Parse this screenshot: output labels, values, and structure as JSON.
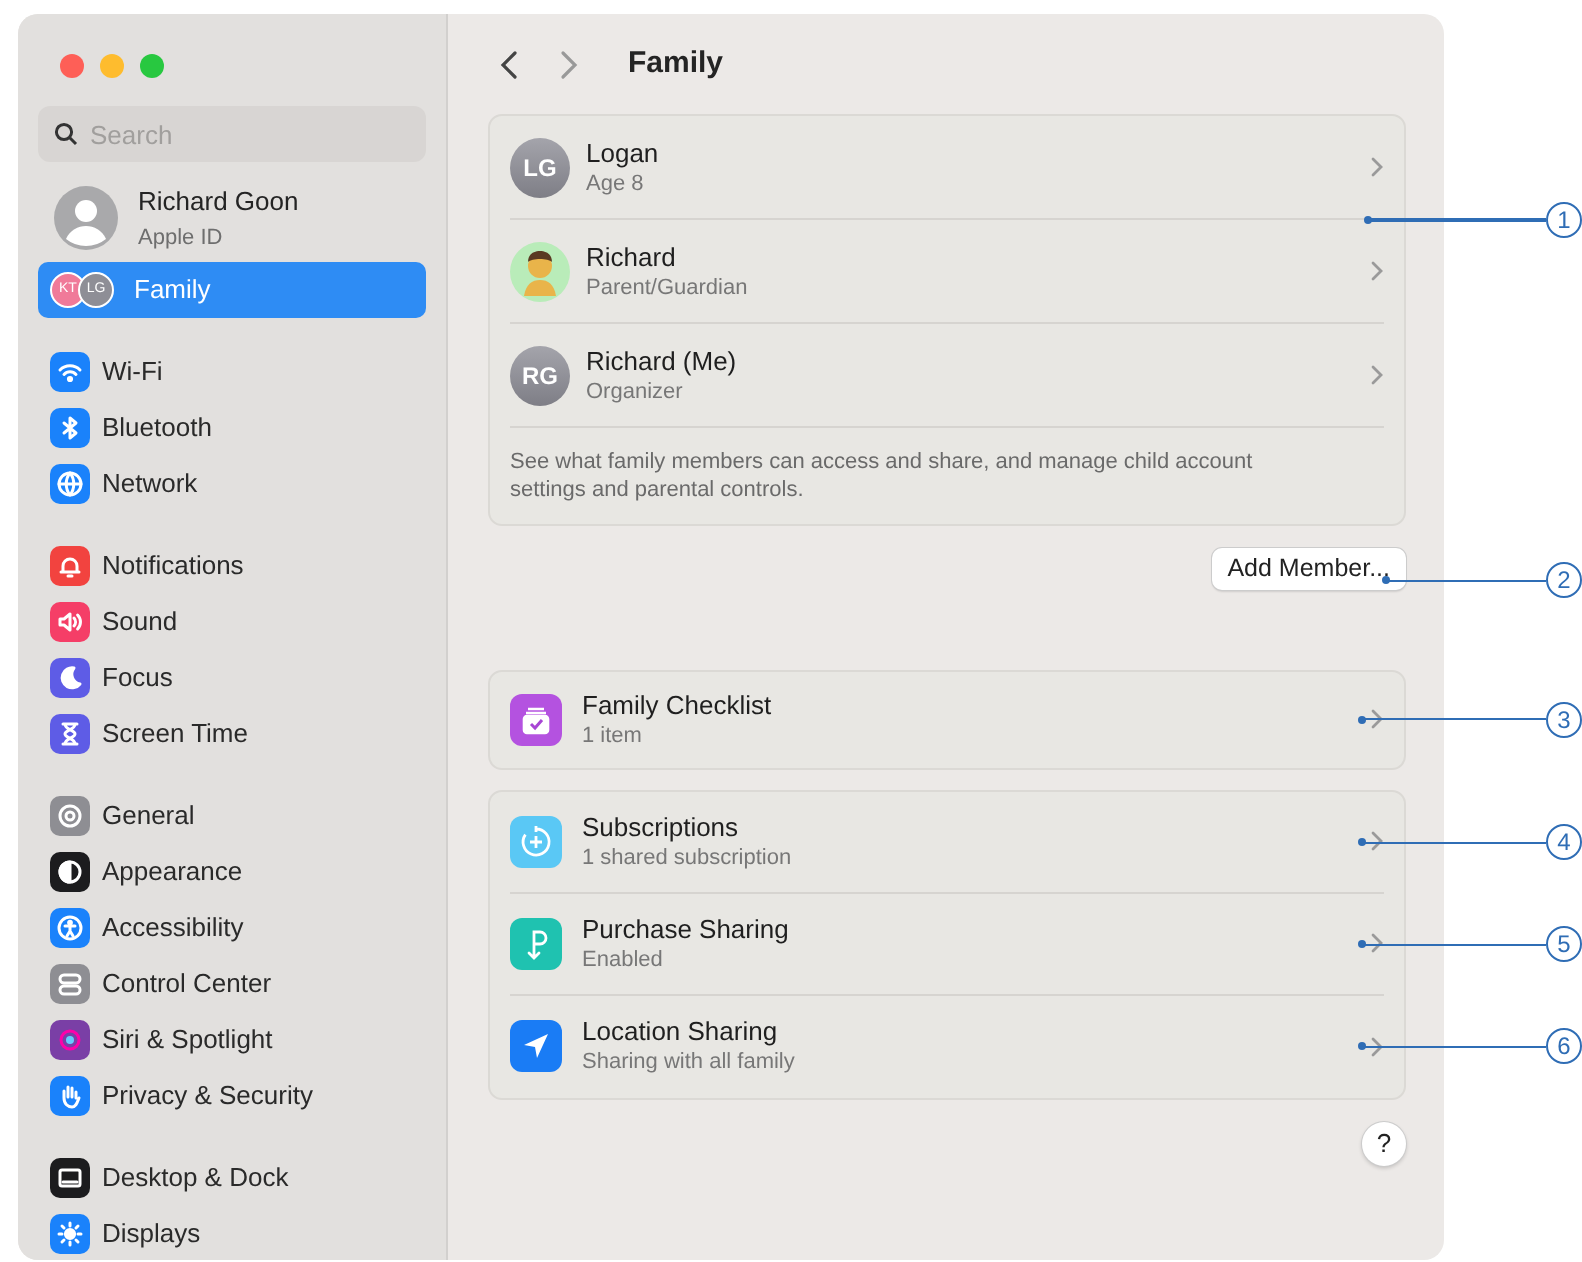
{
  "window": {
    "controls": [
      {
        "color": "#fe5f57"
      },
      {
        "color": "#febc2e"
      },
      {
        "color": "#28c840"
      }
    ]
  },
  "sidebar": {
    "search": {
      "placeholder": "Search"
    },
    "account": {
      "name": "Richard Goon",
      "subtitle": "Apple ID"
    },
    "family": {
      "label": "Family",
      "selected": true,
      "avatars": [
        {
          "initials": "KT",
          "color": "#f07a99"
        },
        {
          "initials": "LG",
          "color": "#8e8e96"
        }
      ]
    },
    "groups": [
      [
        {
          "label": "Wi-Fi",
          "color": "#1a82fb",
          "selected": false
        },
        {
          "label": "Bluetooth",
          "color": "#1a82fb",
          "selected": false
        },
        {
          "label": "Network",
          "color": "#1a82fb",
          "selected": false
        }
      ],
      [
        {
          "label": "Notifications",
          "color": "#f2433f",
          "selected": false
        },
        {
          "label": "Sound",
          "color": "#f53e67",
          "selected": false
        },
        {
          "label": "Focus",
          "color": "#5e5ce6",
          "selected": false
        },
        {
          "label": "Screen Time",
          "color": "#5e5ce6",
          "selected": false
        }
      ],
      [
        {
          "label": "General",
          "color": "#8e8e93",
          "selected": false
        },
        {
          "label": "Appearance",
          "color": "#1c1c1e",
          "selected": false
        },
        {
          "label": "Accessibility",
          "color": "#1a82fb",
          "selected": false
        },
        {
          "label": "Control Center",
          "color": "#8e8e93",
          "selected": false
        },
        {
          "label": "Siri & Spotlight",
          "color": "#7a3fa6",
          "selected": false
        },
        {
          "label": "Privacy & Security",
          "color": "#1a82fb",
          "selected": false
        }
      ],
      [
        {
          "label": "Desktop & Dock",
          "color": "#1c1c1e",
          "selected": false
        },
        {
          "label": "Displays",
          "color": "#1a82fb",
          "selected": false
        }
      ]
    ]
  },
  "main": {
    "title": "Family",
    "members": [
      {
        "kind": "initials",
        "initials": "LG",
        "name": "Logan",
        "subtitle": "Age 8"
      },
      {
        "kind": "picture",
        "name": "Richard",
        "subtitle": "Parent/Guardian"
      },
      {
        "kind": "initials",
        "initials": "RG",
        "name": "Richard (Me)",
        "subtitle": "Organizer"
      }
    ],
    "members_note": "See what family members can access and share, and manage child account settings and parental controls.",
    "add_button": "Add Member...",
    "groups": [
      [
        {
          "title": "Family Checklist",
          "subtitle": "1 item",
          "color": "#b452e0"
        }
      ],
      [
        {
          "title": "Subscriptions",
          "subtitle": "1 shared subscription",
          "color": "#5ac8f5"
        },
        {
          "title": "Purchase Sharing",
          "subtitle": "Enabled",
          "color": "#1fc2b0"
        },
        {
          "title": "Location Sharing",
          "subtitle": "Sharing with all family",
          "color": "#1a7cf5"
        }
      ]
    ],
    "help": "?"
  },
  "callouts": [
    {
      "label": "1"
    },
    {
      "label": "2"
    },
    {
      "label": "3"
    },
    {
      "label": "4"
    },
    {
      "label": "5"
    },
    {
      "label": "6"
    }
  ]
}
